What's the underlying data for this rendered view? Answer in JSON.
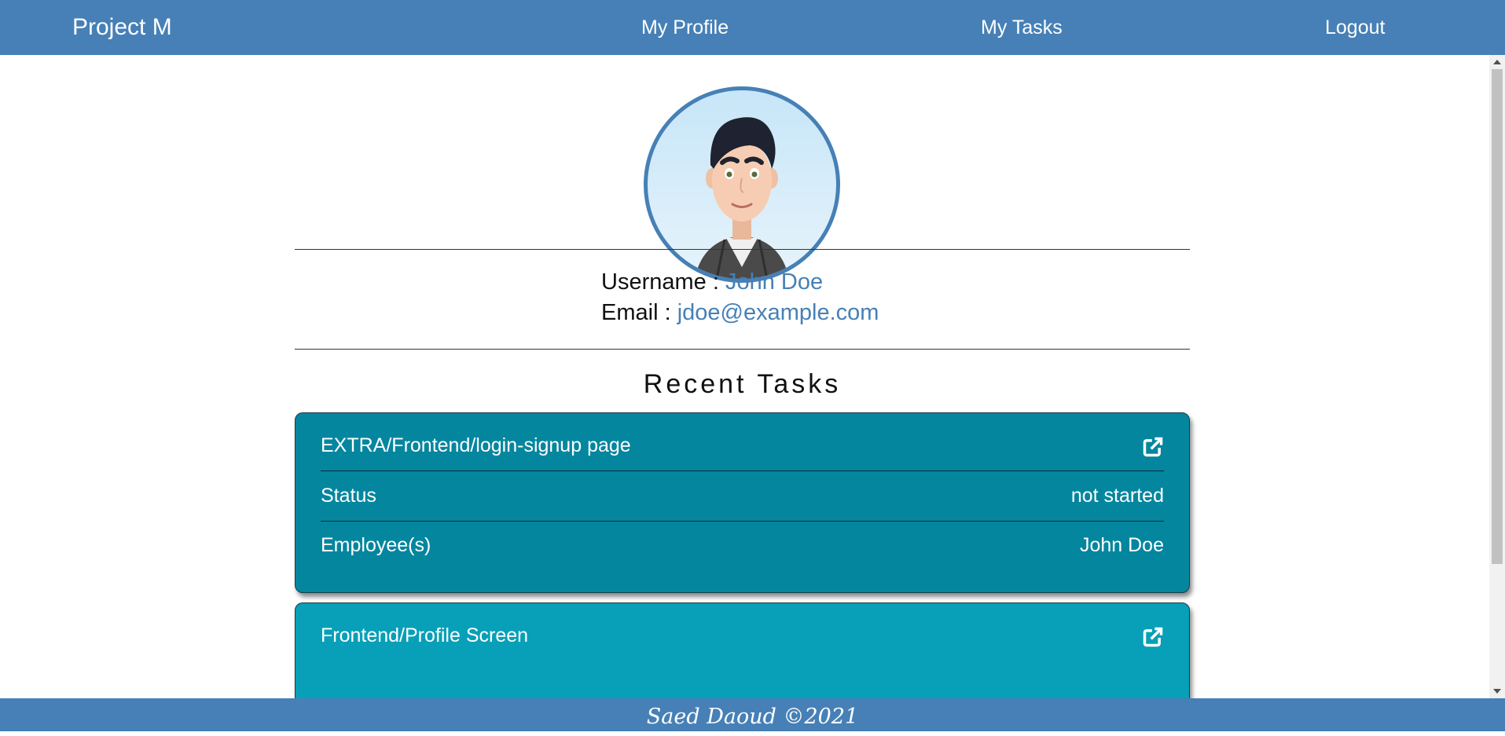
{
  "navbar": {
    "brand": "Project M",
    "links": [
      "My Profile",
      "My Tasks",
      "Logout"
    ],
    "color": "#4680b6"
  },
  "profile": {
    "username_label": "Username : ",
    "username": "John Doe",
    "email_label": "Email : ",
    "email": "jdoe@example.com"
  },
  "recent_tasks": {
    "title": "Recent Tasks",
    "tasks": [
      {
        "name": "EXTRA/Frontend/login-signup page",
        "status_label": "Status",
        "status": "not started",
        "employees_label": "Employee(s)",
        "employees": "John Doe",
        "color": "#05869f"
      },
      {
        "name": "Frontend/Profile Screen",
        "color": "#07a0b8"
      }
    ]
  },
  "footer": {
    "text": "Saed Daoud ©2021"
  },
  "icons": {
    "external_link": "external-link-icon",
    "avatar": "avatar"
  }
}
